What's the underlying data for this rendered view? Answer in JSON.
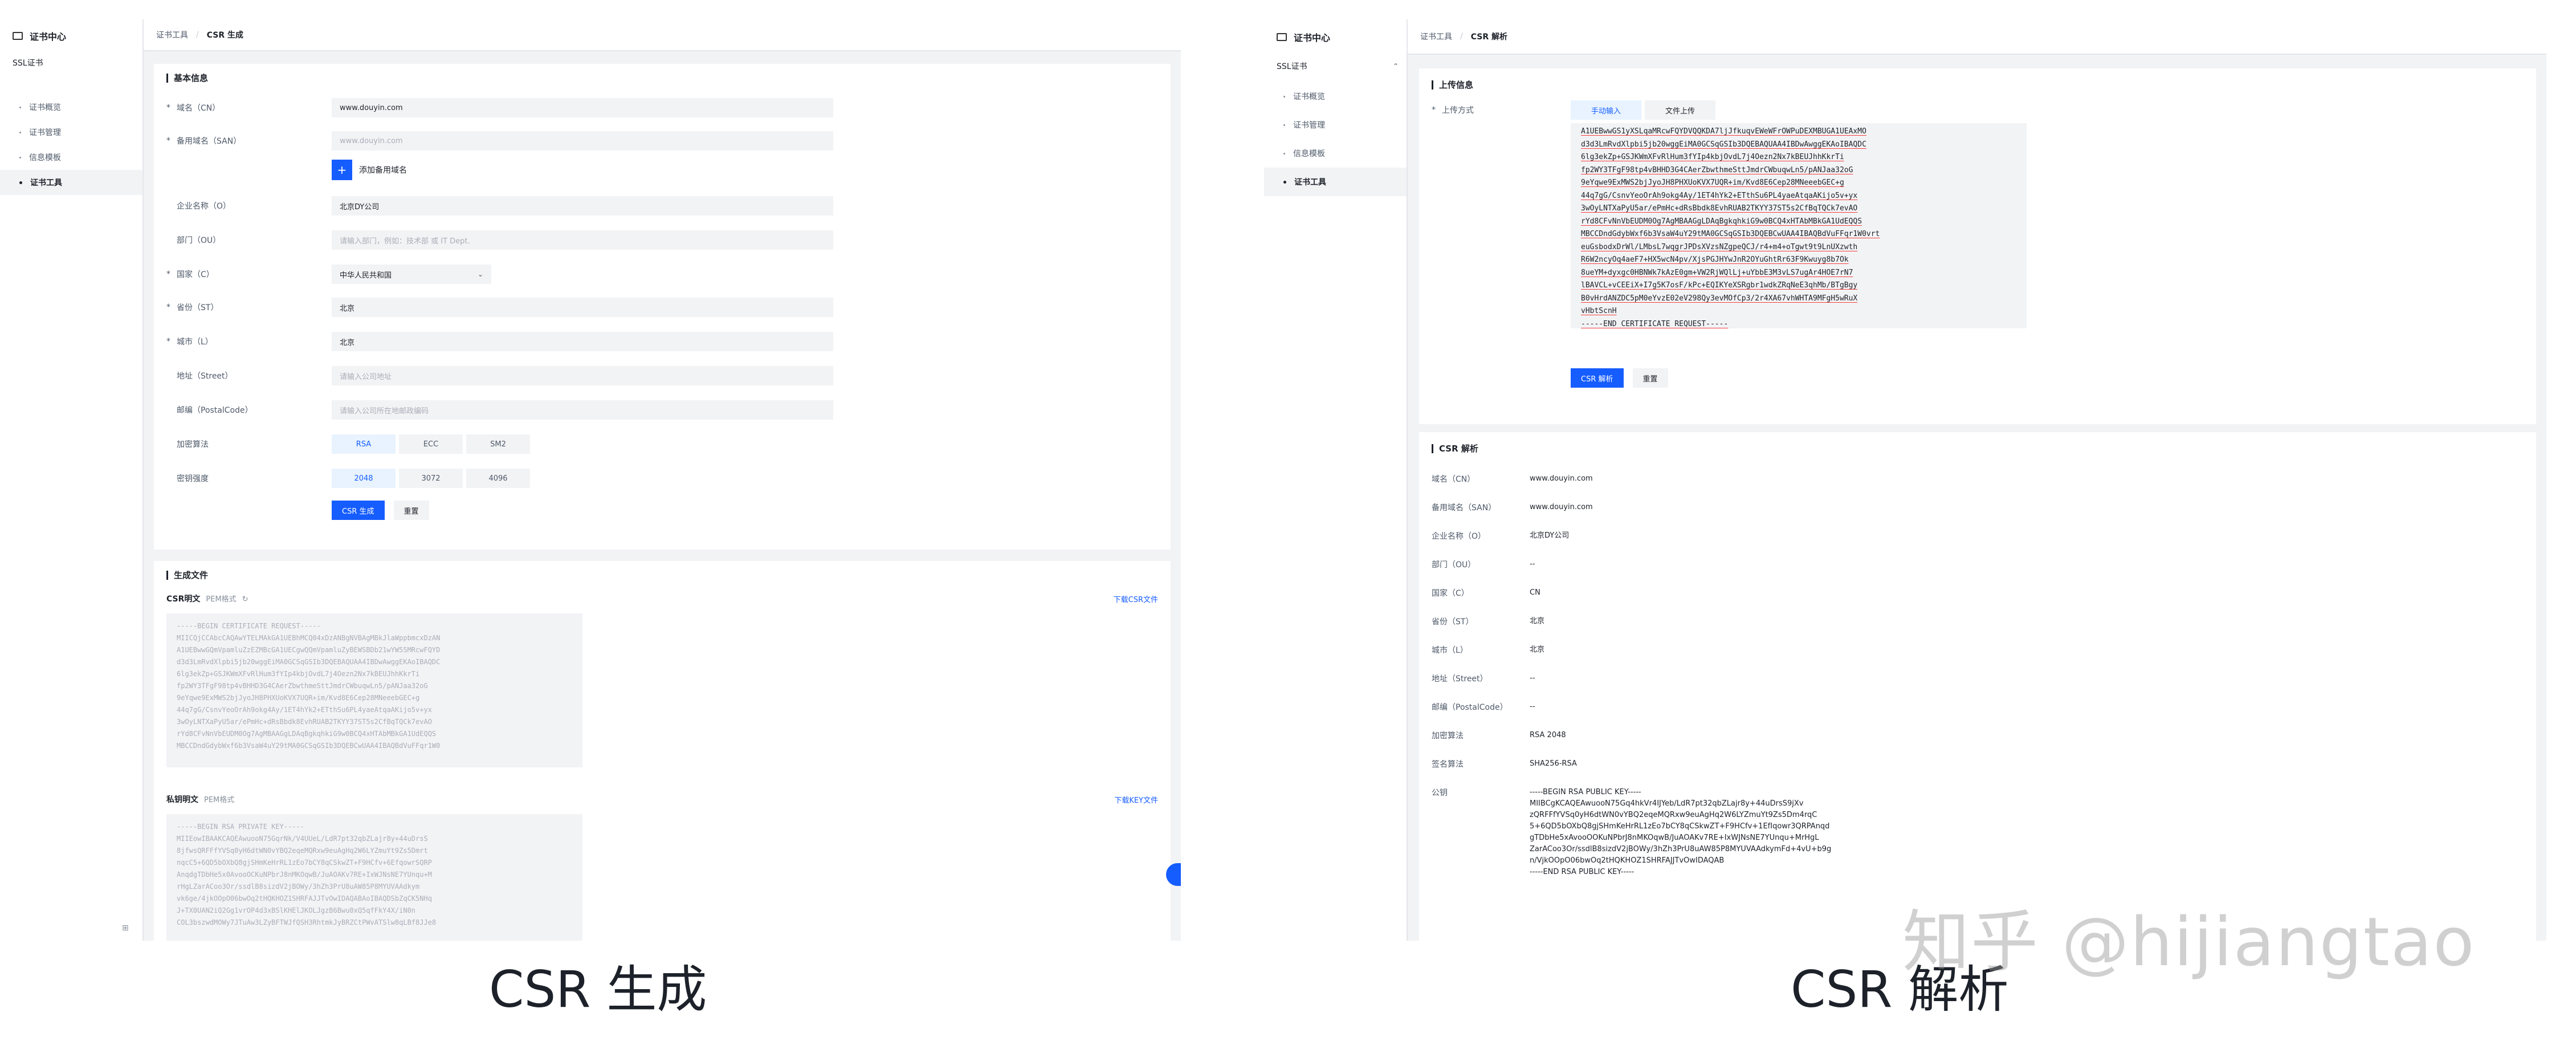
{
  "left": {
    "sidebar": {
      "title": "证书中心",
      "group": "SSL证书",
      "items": [
        {
          "label": "证书概览",
          "active": false
        },
        {
          "label": "证书管理",
          "active": false
        },
        {
          "label": "信息模板",
          "active": false
        },
        {
          "label": "证书工具",
          "active": true
        }
      ],
      "bottom_icon": "collapse-icon"
    },
    "breadcrumb": {
      "parent": "证书工具",
      "sep": "/",
      "current": "CSR 生成"
    },
    "basic": {
      "title": "基本信息",
      "cn": {
        "label": "域名（CN）",
        "value": "www.douyin.com"
      },
      "san": {
        "label": "备用域名（SAN）",
        "placeholder": "www.douyin.com"
      },
      "add_san": "添加备用域名",
      "org": {
        "label": "企业名称（O）",
        "value": "北京DY公司"
      },
      "ou": {
        "label": "部门（OU）",
        "placeholder": "请输入部门，例如：技术部 或 IT Dept."
      },
      "country": {
        "label": "国家（C）",
        "value": "中华人民共和国"
      },
      "state": {
        "label": "省份（ST）",
        "value": "北京"
      },
      "city": {
        "label": "城市（L）",
        "value": "北京"
      },
      "street": {
        "label": "地址（Street）",
        "placeholder": "请输入公司地址"
      },
      "postal": {
        "label": "邮编（PostalCode）",
        "placeholder": "请输入公司所在地邮政编码"
      },
      "algo": {
        "label": "加密算法",
        "options": [
          "RSA",
          "ECC",
          "SM2"
        ],
        "selected": "RSA"
      },
      "keylen": {
        "label": "密钥强度",
        "options": [
          "2048",
          "3072",
          "4096"
        ],
        "selected": "2048"
      },
      "submit": "CSR 生成",
      "reset": "重置"
    },
    "generated": {
      "title": "生成文件",
      "csr_label": "CSR明文",
      "csr_format": "PEM格式",
      "csr_download": "下载CSR文件",
      "csr_text": "-----BEGIN CERTIFICATE REQUEST-----\nMIICQjCCAbcCAQAwYTELMAkGA1UEBhMCQ04xDzANBgNVBAgMBkJlaWppbmcxDzAN\nA1UEBwwGQmVpamluZzEZMBcGA1UECgwQQmVpamluZyBEWSBDb21wYW55MRcwFQYD\nd3d3LmRvdXlpbi5jb20wggEiMA0GCSqGSIb3DQEBAQUAA4IBDwAwggEKAoIBAQDC\n6lg3ekZp+GSJKWmXFvRlHum3fYIp4kbjOvdL7j4Oezn2Nx7kBEUJhhKkrTi\nfp2WY3TFgF98tp4vBHHD3G4CAerZbwthmeSttJmdrCWbuqwLn5/pANJaa32oG\n9eYqwe9ExMWS2bjJyoJH8PHXUoKVX7UQR+im/Kvd8E6Cep28MNeeebGEC+g\n44q7gG/CsnvYeoOrAh9okg4Ay/1ET4hYk2+ETthSu6PL4yaeAtqaAKijo5v+yx\n3wOyLNTXaPyU5ar/ePmHc+dRsBbdk8EvhRUAB2TKYY37ST5s2CfBqTQCk7evAO\nrYd8CFvNnVbEUDM0Og7AgMBAAGgLDAqBgkqhkiG9w0BCQ4xHTAbMBkGA1UdEQQS\nMBCCDndGdybWxf6b3VsaW4uY29tMA0GCSqGSIb3DQEBCwUAA4IBAQBdVuFFqr1W0",
      "key_label": "私钥明文",
      "key_format": "PEM格式",
      "key_download": "下载KEY文件",
      "key_text": "-----BEGIN RSA PRIVATE KEY-----\nMIIEowIBAAKCAQEAwuooN75GqrNk/V4UUeL/LdR7pt32qbZLajr8y+44uDrsS\n8jfwsQRFFfYVSq0yH6dtWN0vYBQ2eqeMQRxw9euAgHq2W6LYZmuYt9Zs5Dmrt\nnqcC5+6QD5bOXbQ8gjSHmKeHrRL1zEo7bCY8qCSkwZT+F9HCfv+6EfqowrSQRP\nAnqdgTDbHe5x0AvooOCKuNPbrJ8nMKOqwB/JuAOAKv7RE+IxWJNsNE7YUnqu+M\nrHgLZarACoo3Or/ssdlB8sizdV2jBOWy/3hZh3PrU8uAW85P8MYUVAAdkym\nvk6ge/4jkOOpO06bwOq2tHQKHOZ1SHRFAJJTvOwIDAQABAoIBAQDSbZqCK5NHq\nJ+TX0UAN2iQ2Gg1vrOP4d3xBSlKHElJKOLJgzB6Bwu0xQ5qfFkY4X/iN0n\nCOL3bszwdMOWy7JTuAw3LZyBFTWJfQSH3RhtmkJyBRZCtPWvATSlw8qLBf8JJe8"
    }
  },
  "right": {
    "sidebar": {
      "title": "证书中心",
      "group": "SSL证书",
      "group_chevron": "chevron-up-icon",
      "items": [
        {
          "label": "证书概览",
          "active": false
        },
        {
          "label": "证书管理",
          "active": false
        },
        {
          "label": "信息模板",
          "active": false
        },
        {
          "label": "证书工具",
          "active": true
        }
      ]
    },
    "breadcrumb": {
      "parent": "证书工具",
      "sep": "/",
      "current": "CSR 解析"
    },
    "upload": {
      "title": "上传信息",
      "method_label": "上传方式",
      "tabs": [
        {
          "label": "手动输入",
          "active": true
        },
        {
          "label": "文件上传",
          "active": false
        }
      ],
      "csr_text": "A1UEBwwGS1yXSLqaMRcwFQYDVQQKDA7ljJfkuqvEWeWFrOWPuDEXMBUGA1UEAxMO\nd3d3LmRvdXlpbi5jb20wggEiMA0GCSqGSIb3DQEBAQUAA4IBDwAwggEKAoIBAQDC\n6lg3ekZp+GSJKWmXFvRlHum3fYIp4kbjOvdL7j4Oezn2Nx7kBEUJhhKkrTi\nfp2WY3TFgF98tp4vBHHD3G4CAerZbwthmeSttJmdrCWbuqwLn5/pANJaa32oG\n9eYqwe9ExMWS2bjJyoJH8PHXUoKVX7UQR+im/Kvd8E6Cep28MNeeebGEC+g\n44q7gG/CsnvYeoOrAh9okg4Ay/1ET4hYk2+ETthSu6PL4yaeAtqaAKijo5v+yx\n3wOyLNTXaPyU5ar/ePmHc+dRsBbdk8EvhRUAB2TKYY37ST5s2CfBqTQCk7evAO\nrYd8CFvNnVbEUDM0Og7AgMBAAGgLDAqBgkqhkiG9w0BCQ4xHTAbMBkGA1UdEQQS\nMBCCDndGdybWxf6b3VsaW4uY29tMA0GCSqGSIb3DQEBCwUAA4IBAQBdVuFFqr1W0vrt\neuGsbodxDrWl/LMbsL7wqgrJPDsXVzsNZgpeQCJ/r4+m4+oTgwt9t9LnUXzwth\nR6W2ncyOq4aeF7+HX5wcN4pv/XjsPGJHYwJnR2OYuGhtRr63F9Kwuyg8b7Ok\n8ueYM+dyxgc0HBNWk7kAzE0gm+VW2RjWQlLj+uYbbE3M3vLS7ugAr4HOE7rN7\nlBAVCL+vCEEiX+I7g5K7osF/kPc+EQIKYeXSRgbr1wdkZRqNeE3qhMb/BTgBgy\nB0vHrdANZDC5pM0eYvzE02eV298Qy3evMOfCp3/2r4XA67vhWHTA9MFgH5wRuX\nvHbtScnH\n-----END CERTIFICATE REQUEST-----",
      "submit": "CSR 解析",
      "reset": "重置"
    },
    "parsed": {
      "title": "CSR 解析",
      "rows": [
        {
          "label": "域名（CN）",
          "value": "www.douyin.com"
        },
        {
          "label": "备用域名（SAN）",
          "value": "www.douyin.com"
        },
        {
          "label": "企业名称（O）",
          "value": "北京DY公司"
        },
        {
          "label": "部门（OU）",
          "value": "--"
        },
        {
          "label": "国家（C）",
          "value": "CN"
        },
        {
          "label": "省份（ST）",
          "value": "北京"
        },
        {
          "label": "城市（L）",
          "value": "北京"
        },
        {
          "label": "地址（Street）",
          "value": "--"
        },
        {
          "label": "邮编（PostalCode）",
          "value": "--"
        },
        {
          "label": "加密算法",
          "value": "RSA 2048"
        },
        {
          "label": "签名算法",
          "value": "SHA256-RSA"
        },
        {
          "label": "公钥",
          "value": "-----BEGIN RSA PUBLIC KEY-----\nMIIBCgKCAQEAwuooN75Gq4hkVr4IJYeb/LdR7pt32qbZLajr8y+44uDrsS9jXv\nzQRFFfYVSq0yH6dtWN0vYBQ2eqeMQRxw9euAgHq2W6LYZmuYt9Zs5Dm4rqC\n5+6QD5bOXbQ8gjSHmKeHrRL1zEo7bCY8qCSkwZT+F9HCfv+1EfIqowr3QRPAnqd\ngTDbHe5xAvooOOKuNPbrJ8nMKOqwB/JuAOAKv7RE+IxWJNsNE7YUnqu+MrHgL\nZarACoo3Or/ssdlB8sizdV2jBOWy/3hZh3PrU8uAW85P8MYUVAAdkymFd+4vU+b9g\nn/VjkOOpO06bwOq2tHQKHOZ1SHRFAJJTvOwIDAQAB\n-----END RSA PUBLIC KEY-----"
        }
      ]
    }
  },
  "captions": {
    "left": "CSR 生成",
    "right": "CSR 解析"
  },
  "watermark": "知乎 @hijiangtao",
  "colors": {
    "primary": "#165dff",
    "bg": "#f2f3f5"
  }
}
